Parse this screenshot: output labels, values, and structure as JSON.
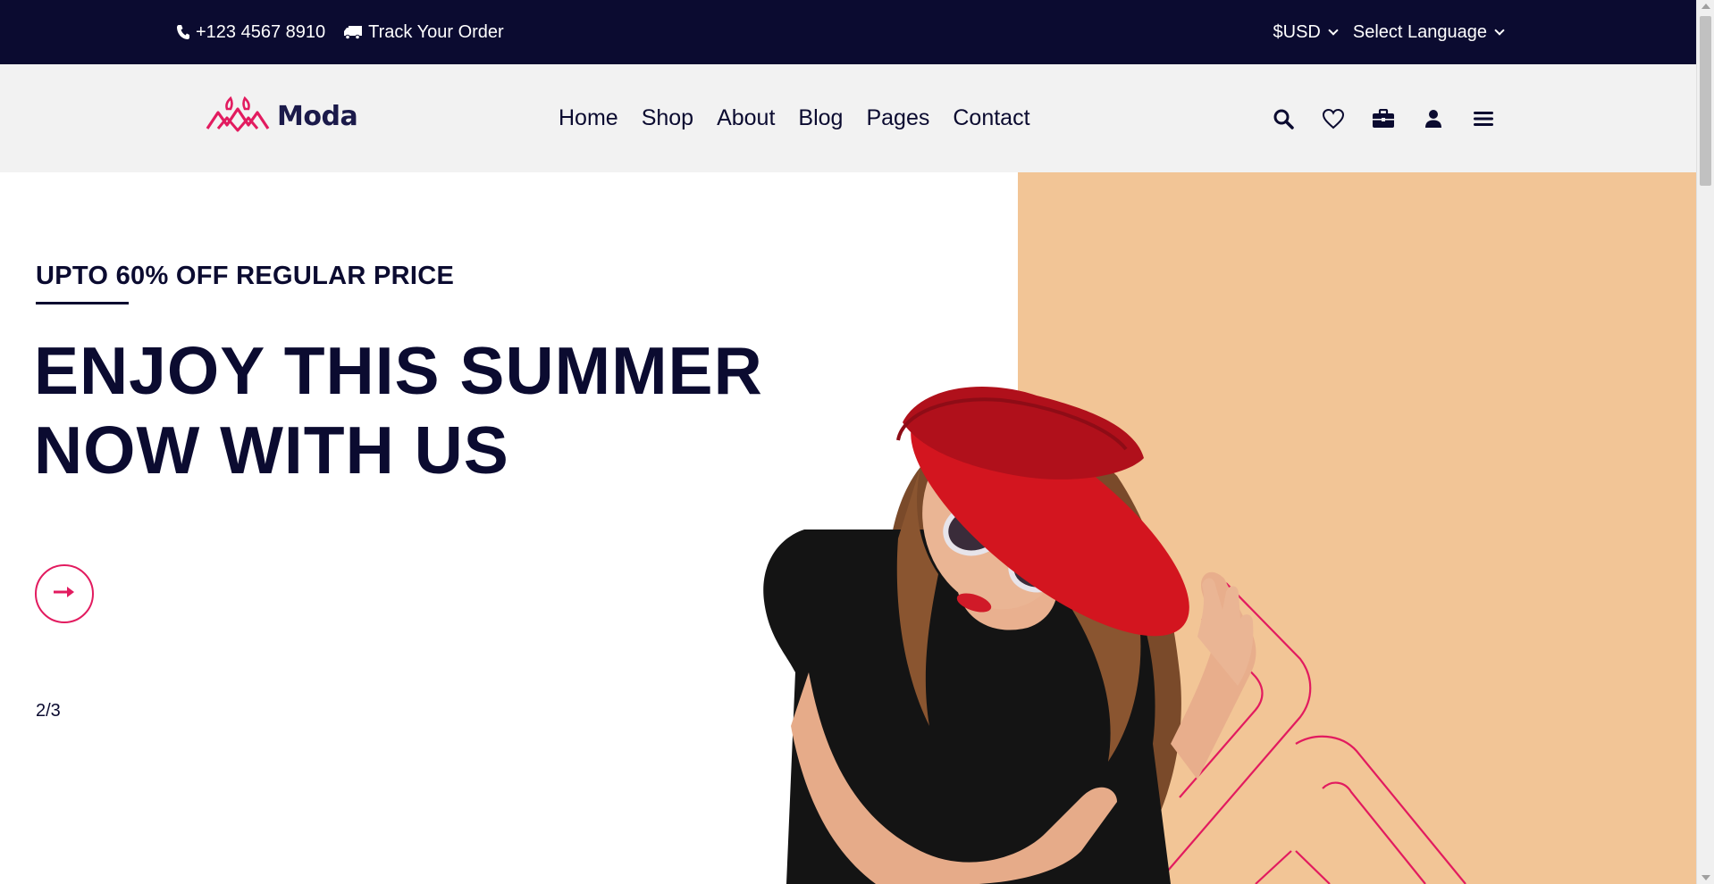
{
  "topbar": {
    "phone": "+123 4567 8910",
    "track_order": "Track Your Order",
    "currency": "$USD",
    "language": "Select Language"
  },
  "header": {
    "logo_text": "Moda",
    "nav": [
      "Home",
      "Shop",
      "About",
      "Blog",
      "Pages",
      "Contact"
    ],
    "icons": [
      "search-icon",
      "heart-icon",
      "briefcase-icon",
      "user-icon",
      "menu-icon"
    ]
  },
  "hero": {
    "eyebrow": "UPTO 60% OFF REGULAR PRICE",
    "headline_line1": "ENJOY THIS SUMMER",
    "headline_line2": "NOW WITH US",
    "slide_counter": "2/3"
  },
  "colors": {
    "navy": "#0b0b30",
    "accent": "#e21b5f",
    "peach": "#f2c596",
    "header_bg": "#f2f2f2"
  }
}
